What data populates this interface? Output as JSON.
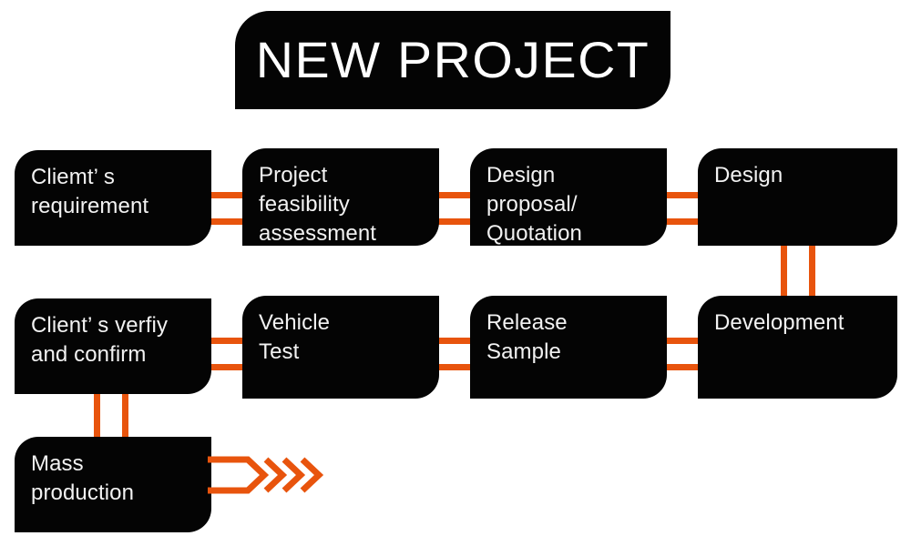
{
  "title": {
    "text": "NEW PROJECT"
  },
  "colors": {
    "node_fill": "#040404",
    "node_text": "#f2f2f2",
    "connector": "#e8540d",
    "background": "#ffffff"
  },
  "flow": {
    "row1": [
      {
        "id": "clients-requirement",
        "label": "Cliemt’ s\nrequirement"
      },
      {
        "id": "project-feasibility-assessment",
        "label": "Project\nfeasibility\nassessment"
      },
      {
        "id": "design-proposal-quotation",
        "label": "Design\nproposal/\nQuotation"
      },
      {
        "id": "design",
        "label": "Design"
      }
    ],
    "row2": [
      {
        "id": "clients-verify-and-confirm",
        "label": "Client’ s verfiy\nand confirm"
      },
      {
        "id": "vehicle-test",
        "label": "Vehicle\nTest"
      },
      {
        "id": "release-sample",
        "label": "Release\nSample"
      },
      {
        "id": "development",
        "label": "Development"
      }
    ],
    "row3": [
      {
        "id": "mass-production",
        "label": "Mass\nproduction"
      }
    ]
  },
  "chart_data": {
    "type": "diagram",
    "diagram_kind": "process-flowchart",
    "title": "NEW PROJECT",
    "node_count": 9,
    "nodes": [
      "Cliemt’ s requirement",
      "Project feasibility assessment",
      "Design proposal/ Quotation",
      "Design",
      "Development",
      "Release Sample",
      "Vehicle Test",
      "Client’ s verfiy and confirm",
      "Mass production"
    ],
    "edges": [
      {
        "from": "Cliemt’ s requirement",
        "to": "Project feasibility assessment",
        "direction": "right"
      },
      {
        "from": "Project feasibility assessment",
        "to": "Design proposal/ Quotation",
        "direction": "right"
      },
      {
        "from": "Design proposal/ Quotation",
        "to": "Design",
        "direction": "right"
      },
      {
        "from": "Design",
        "to": "Development",
        "direction": "down"
      },
      {
        "from": "Development",
        "to": "Release Sample",
        "direction": "left"
      },
      {
        "from": "Release Sample",
        "to": "Vehicle Test",
        "direction": "left"
      },
      {
        "from": "Vehicle Test",
        "to": "Client’ s verfiy and confirm",
        "direction": "left"
      },
      {
        "from": "Client’ s verfiy and confirm",
        "to": "Mass production",
        "direction": "down"
      },
      {
        "from": "Mass production",
        "to": "end-arrow",
        "direction": "right"
      }
    ]
  }
}
